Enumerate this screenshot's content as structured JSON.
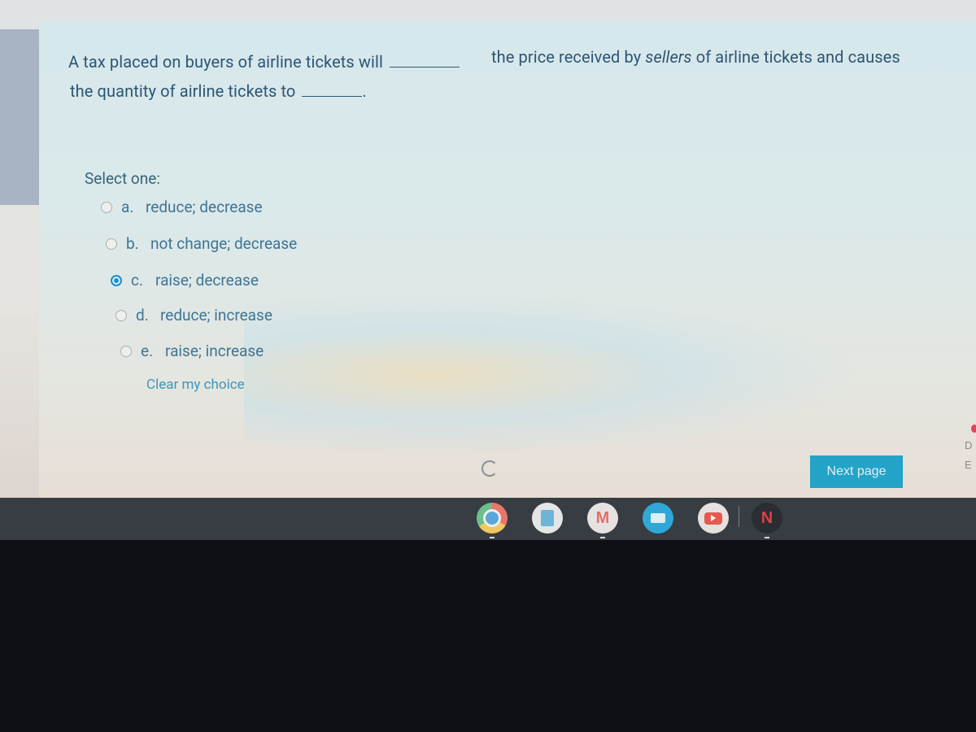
{
  "question": {
    "line1_before_blank": "A tax placed on buyers of airline tickets will",
    "line1_after_blank_part1": "the price received by",
    "line1_emphasis": "sellers",
    "line1_after_blank_part2": "of airline tickets and causes",
    "line2_before_blank": "the quantity of airline tickets to",
    "line2_end": "."
  },
  "select_label": "Select one:",
  "options": [
    {
      "letter": "a.",
      "text": "reduce; decrease",
      "selected": false
    },
    {
      "letter": "b.",
      "text": "not change; decrease",
      "selected": false
    },
    {
      "letter": "c.",
      "text": "raise; decrease",
      "selected": true
    },
    {
      "letter": "d.",
      "text": "reduce; increase",
      "selected": false
    },
    {
      "letter": "e.",
      "text": "raise; increase",
      "selected": false
    }
  ],
  "clear_choice_label": "Clear my choice",
  "next_button_label": "Next page",
  "edge_text": [
    "D",
    "E"
  ],
  "shelf": {
    "apps": [
      {
        "name": "chrome",
        "icon": "chrome-icon"
      },
      {
        "name": "files",
        "icon": "files-icon"
      },
      {
        "name": "gmail",
        "icon": "gmail-icon"
      },
      {
        "name": "messages",
        "icon": "messages-icon"
      },
      {
        "name": "youtube",
        "icon": "youtube-icon"
      },
      {
        "name": "netflix",
        "icon": "netflix-icon",
        "label": "N"
      }
    ]
  },
  "colors": {
    "accent": "#23a3c8",
    "text": "#2d5574",
    "radio_selected": "#1e8fcd"
  }
}
